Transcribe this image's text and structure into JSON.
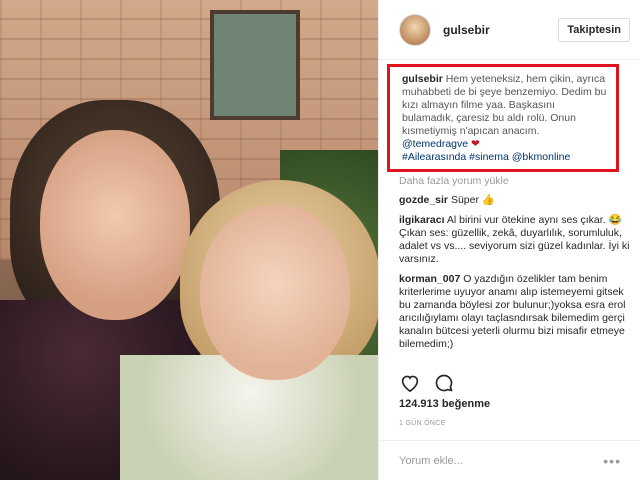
{
  "post": {
    "username": "gulsebir",
    "follow_label": "Takiptesin"
  },
  "caption": {
    "username": "gulsebir",
    "text": "Hem yeteneksiz, hem çikin, ayrıca muhabbeti de bi şeye benzemiyo. Dedim bu kızı almayın filme yaa. Başkasını bulamadık, çaresiz bu aldı rolü. Onun kısmetiymiş n'apıcan anacım.",
    "mention": "@temedragve",
    "heart": "❤",
    "tag1": "#Ailearasında",
    "tag2": "#sinema",
    "tag3": "@bkmonline"
  },
  "load_more": "Daha fazla yorum yükle",
  "comments": [
    {
      "username": "gozde_sir",
      "text": "Süper 👍"
    },
    {
      "username": "ilgikaracı",
      "text": "Al birini vur ötekine aynı ses çıkar. 😂 Çıkan ses: güzellik, zekâ, duyarlılık, sorumluluk, adalet vs vs.... seviyorum sizi güzel kadınlar. İyi ki varsınız."
    },
    {
      "username": "korman_007",
      "text": "O yazdığın özelikler tam benim kriterlerime uyuyor anamı alıp istemeyemi gitsek bu zamanda böylesi zor bulunur;)yoksa esra erol arıcılığıylamı olayı taçlasndırsak bilemedim gerçi kanalın bütcesi yeterli olurmu bizi misafir etmeye bilemedim;)"
    }
  ],
  "icons": {
    "like": "heart-outline-icon",
    "comment": "speech-bubble-icon",
    "more": "ellipsis-icon"
  },
  "likes": "124.913 beğenme",
  "time": "1 GÜN ÖNCE",
  "add_comment": {
    "placeholder": "Yorum ekle..."
  },
  "colors": {
    "highlight_border": "#e0131f",
    "link": "#003569"
  }
}
